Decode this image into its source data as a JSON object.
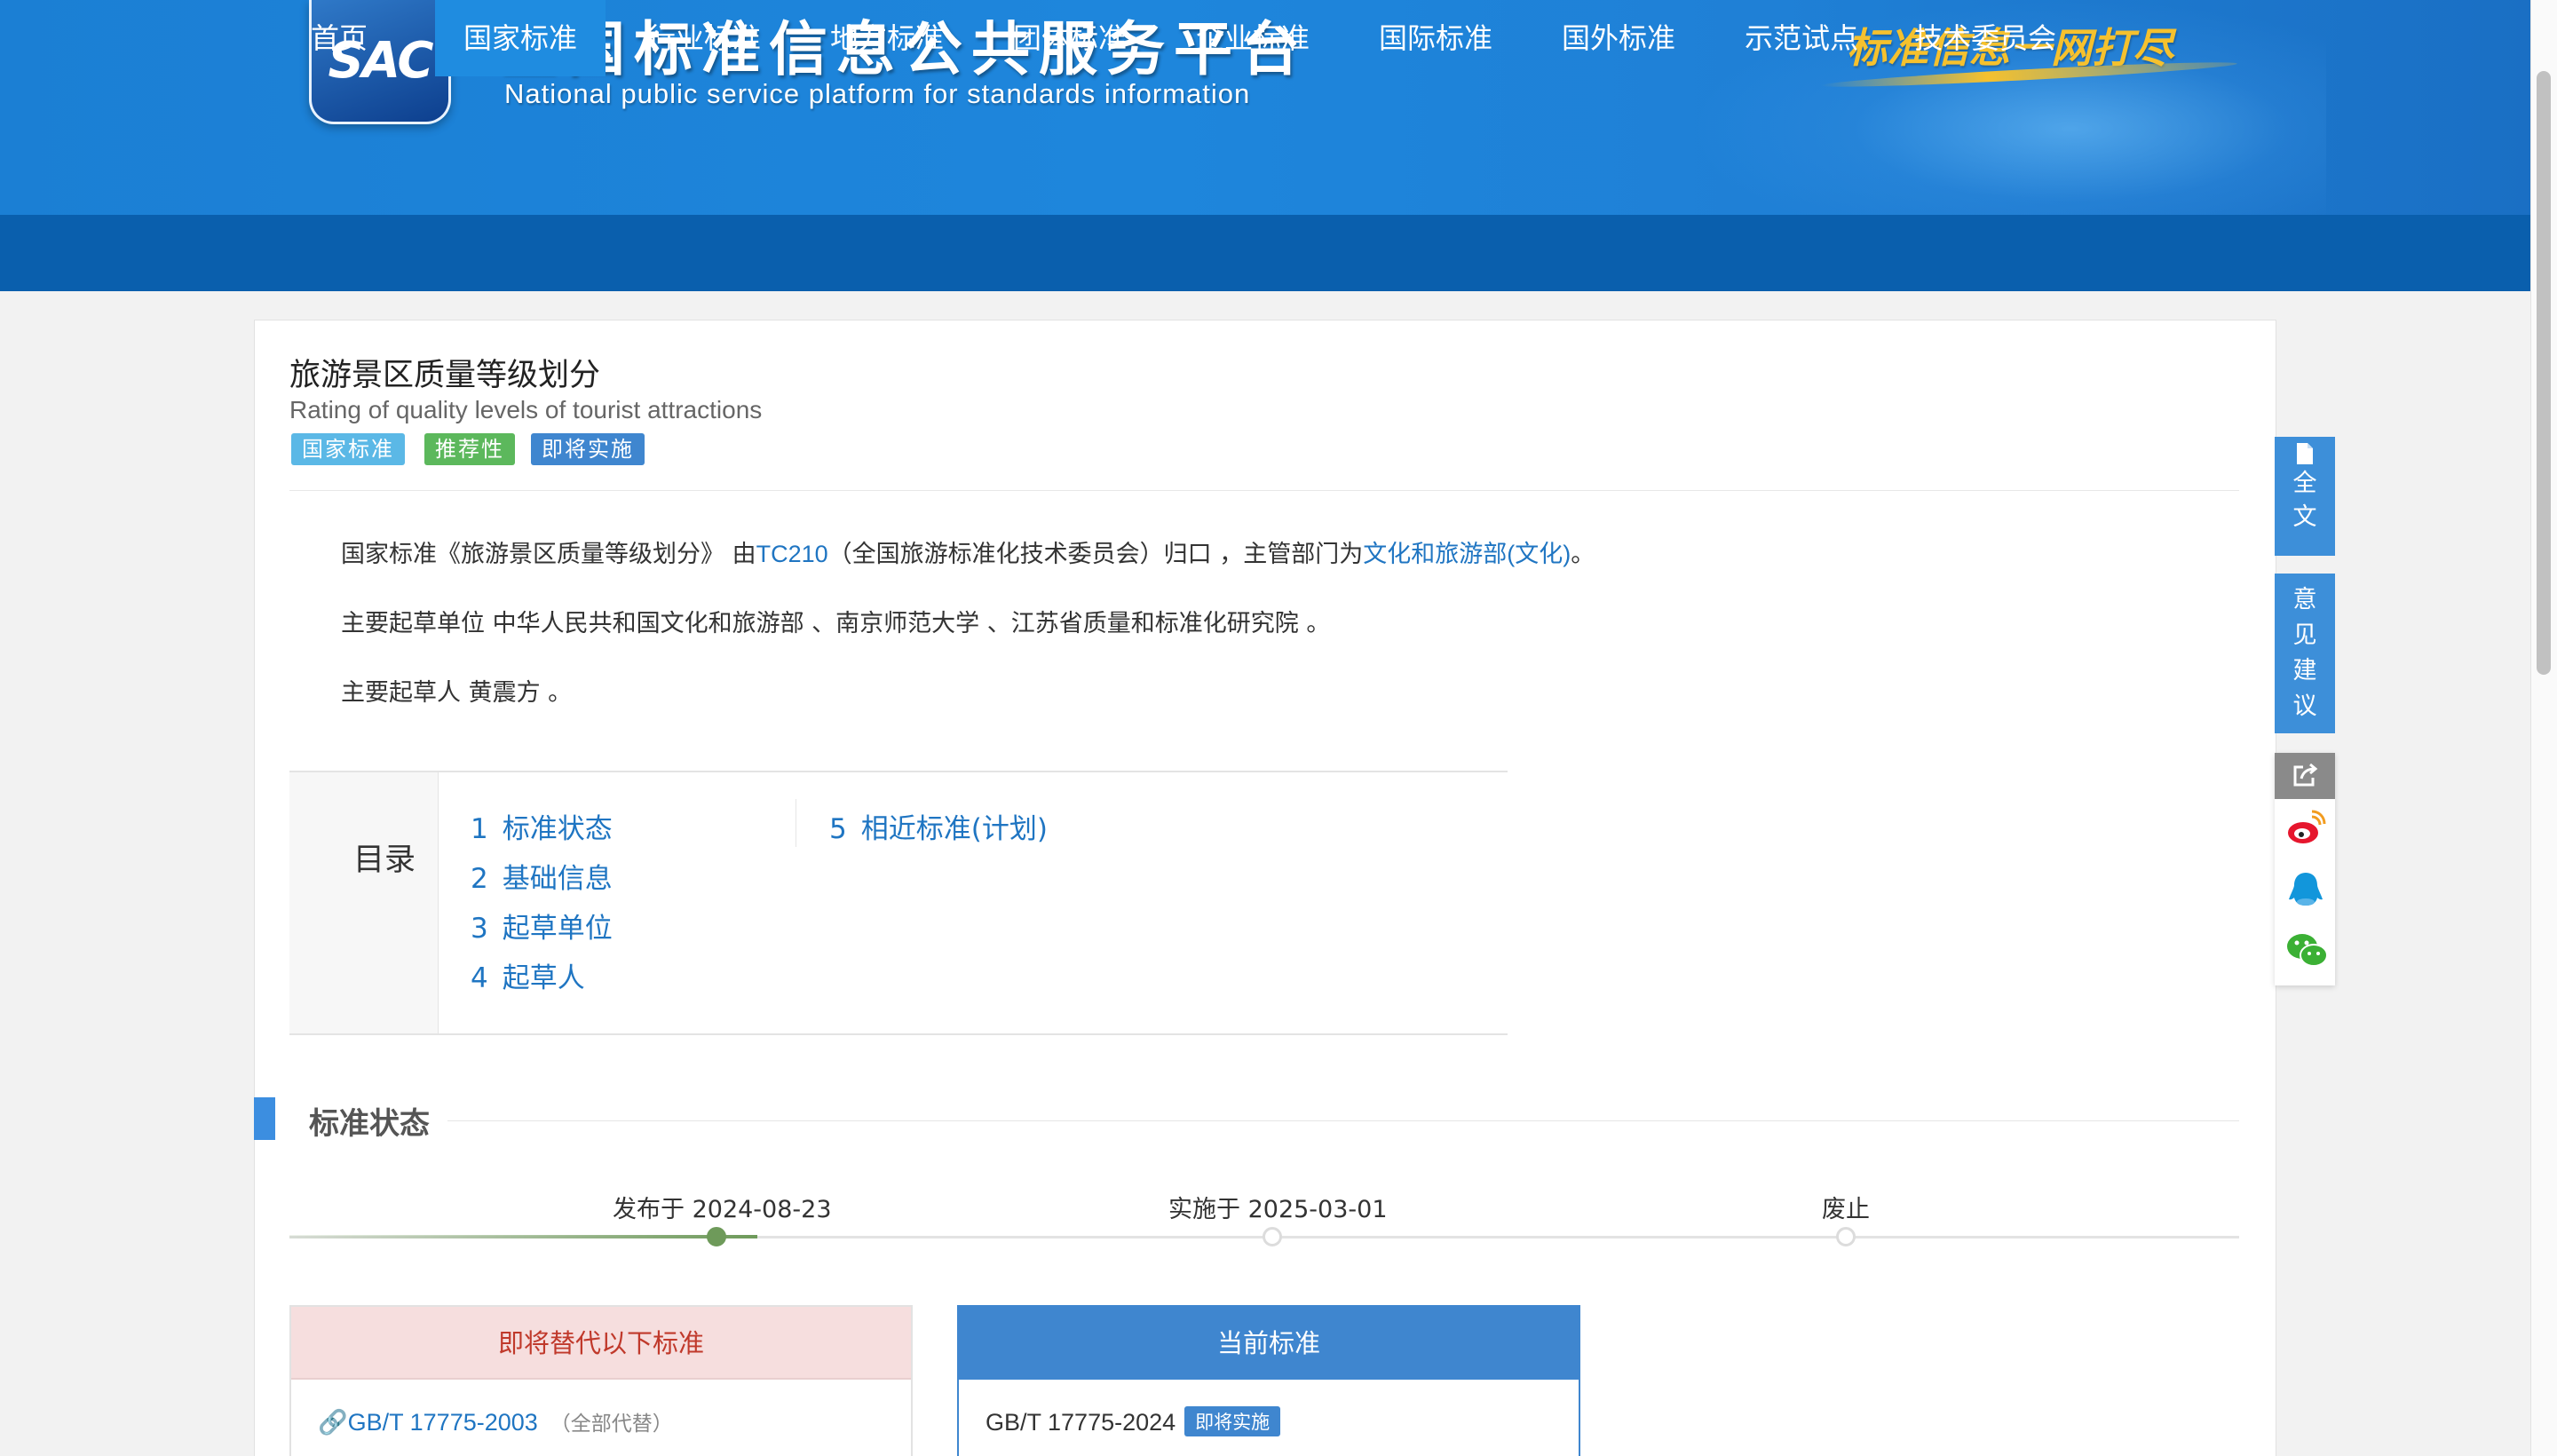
{
  "header": {
    "logo_text": "SAC",
    "title_cn": "全国标准信息公共服务平台",
    "title_en": "National public service platform  for standards information",
    "slogan": "标准信息一网打尽"
  },
  "nav": {
    "items": [
      {
        "label": "首页"
      },
      {
        "label": "国家标准"
      },
      {
        "label": "行业标准"
      },
      {
        "label": "地方标准"
      },
      {
        "label": "团体标准"
      },
      {
        "label": "企业标准"
      },
      {
        "label": "国际标准"
      },
      {
        "label": "国外标准"
      },
      {
        "label": "示范试点"
      },
      {
        "label": "技术委员会"
      }
    ],
    "active": "国家标准"
  },
  "standard": {
    "title": "旅游景区质量等级划分",
    "title_en": "Rating of quality levels of tourist attractions",
    "tags": [
      {
        "label": "国家标准",
        "color": "#5bb8e6"
      },
      {
        "label": "推荐性",
        "color": "#5cb85c"
      },
      {
        "label": "即将实施",
        "color": "#3f86cf"
      }
    ],
    "intro": {
      "p1_prefix": "国家标准《旅游景区质量等级划分》 由",
      "p1_tc": "TC210",
      "p1_mid": "（全国旅游标准化技术委员会）归口 ，主管部门为",
      "p1_dept": "文化和旅游部(文化)",
      "p1_suffix": "。",
      "p2": "主要起草单位 中华人民共和国文化和旅游部 、南京师范大学 、江苏省质量和标准化研究院 。",
      "p3": "主要起草人 黄震方 。"
    }
  },
  "toc": {
    "label": "目录",
    "items": [
      {
        "num": "1",
        "label": "标准状态"
      },
      {
        "num": "2",
        "label": "基础信息"
      },
      {
        "num": "3",
        "label": "起草单位"
      },
      {
        "num": "4",
        "label": "起草人"
      },
      {
        "num": "5",
        "label": "相近标准(计划)"
      }
    ]
  },
  "status_section": {
    "title": "标准状态",
    "timeline": [
      {
        "label": "发布于 2024-08-23",
        "done": true
      },
      {
        "label": "实施于 2025-03-01",
        "done": false
      },
      {
        "label": "废止",
        "done": false
      }
    ],
    "progress_fraction": 0.24
  },
  "replace_box": {
    "title": "即将替代以下标准",
    "std_code": "GB/T 17775-2003",
    "note": "（全部代替）"
  },
  "current_box": {
    "title": "当前标准",
    "std_code": "GB/T 17775-2024",
    "badge": "即将实施"
  },
  "float_toolbar": {
    "fulltext": "全文",
    "feedback": "意见建议"
  },
  "share": {
    "icons": [
      "share-icon",
      "weibo-icon",
      "qq-icon",
      "wechat-icon"
    ]
  }
}
